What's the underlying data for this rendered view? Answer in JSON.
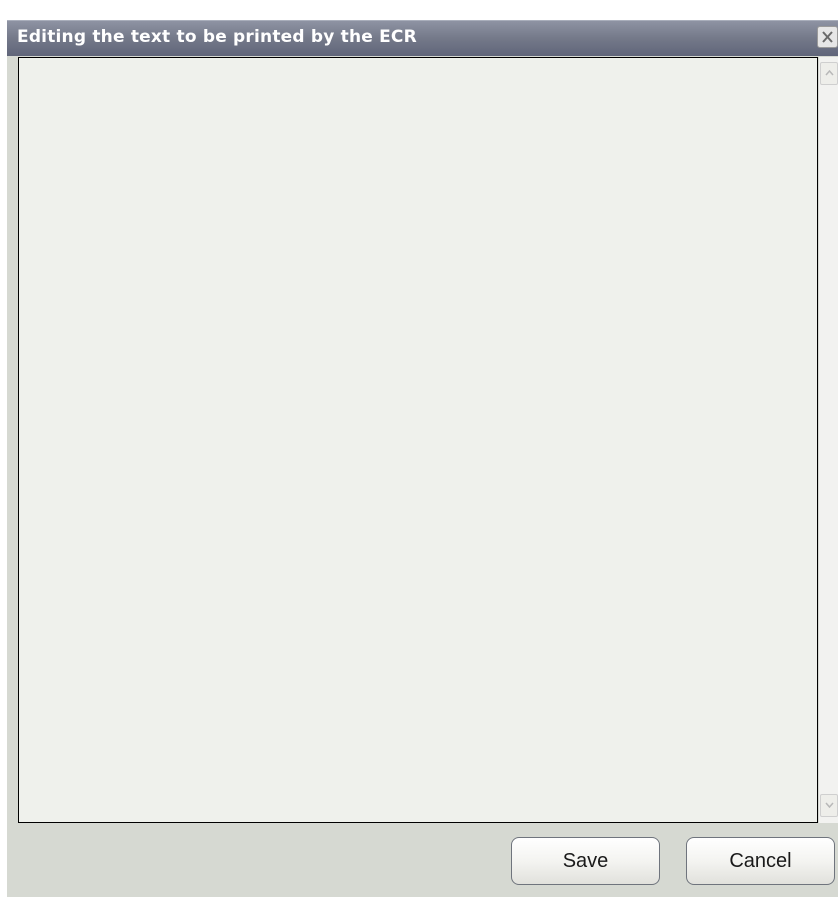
{
  "window": {
    "title": "Editing the text to be printed by the ECR"
  },
  "editor": {
    "value": ""
  },
  "buttons": {
    "save_label": "Save",
    "cancel_label": "Cancel"
  },
  "icons": {
    "close": "close-icon",
    "scroll_up": "chevron-up-icon",
    "scroll_down": "chevron-down-icon"
  },
  "colors": {
    "titlebar": "#747989",
    "editor_background": "#eff1ec",
    "window_background": "#d6d9d2"
  }
}
